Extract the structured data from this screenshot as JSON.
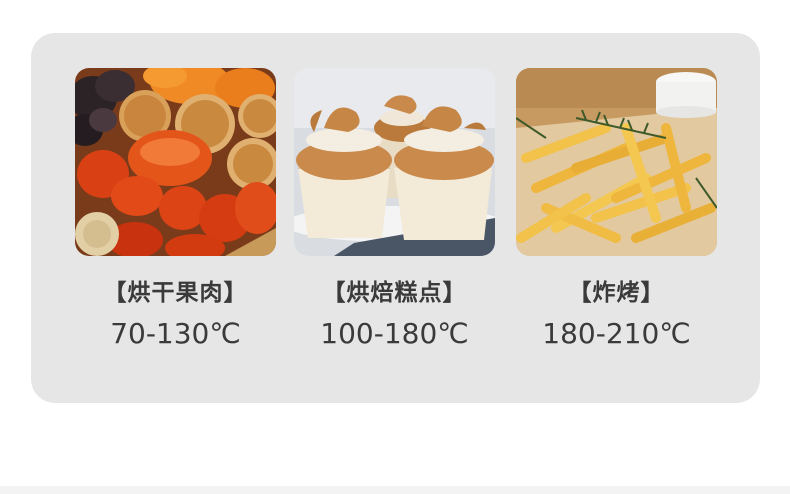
{
  "items": [
    {
      "title": "【烘干果肉】",
      "temperature": "70-130℃",
      "image": "dried-fruit-photo"
    },
    {
      "title": "【烘焙糕点】",
      "temperature": "100-180℃",
      "image": "cupcakes-photo"
    },
    {
      "title": "【炸烤】",
      "temperature": "180-210℃",
      "image": "french-fries-photo"
    }
  ],
  "colors": {
    "panel_background": "#e6e6e6",
    "text": "#3a3a3a"
  }
}
